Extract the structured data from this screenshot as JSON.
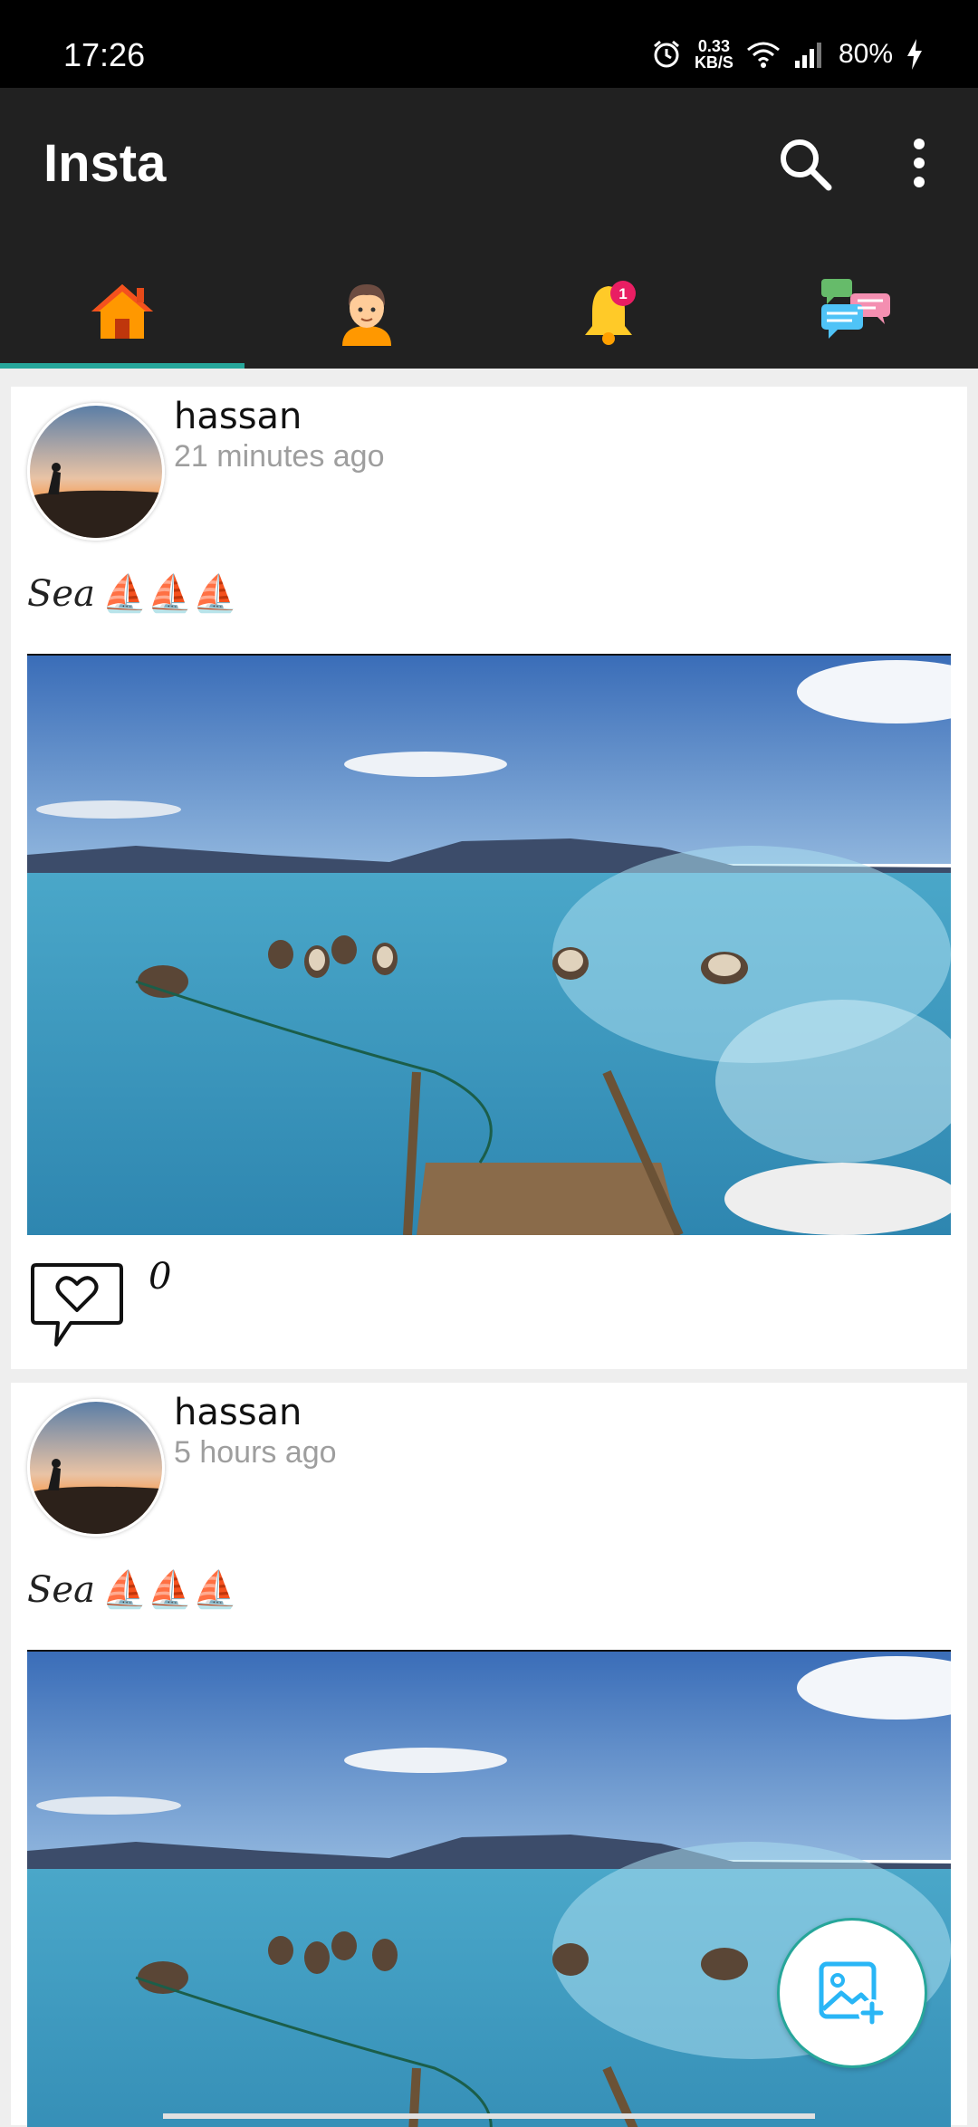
{
  "status_bar": {
    "time": "17:26",
    "net_speed_value": "0.33",
    "net_speed_unit": "KB/S",
    "battery": "80%"
  },
  "app_bar": {
    "title": "Insta",
    "actions": [
      "search-icon",
      "more-vert-icon"
    ]
  },
  "tabs": [
    {
      "icon": "home-icon",
      "selected": true
    },
    {
      "icon": "profile-icon",
      "selected": false
    },
    {
      "icon": "bell-icon",
      "badge": "1",
      "selected": false
    },
    {
      "icon": "chat-bubbles-icon",
      "selected": false
    }
  ],
  "posts": [
    {
      "username": "hassan",
      "time": "21 minutes ago",
      "caption": "Sea",
      "caption_emoji": "⛵⛵⛵",
      "likes": "0"
    },
    {
      "username": "hassan",
      "time": "5 hours ago",
      "caption": "Sea",
      "caption_emoji": "⛵⛵⛵"
    }
  ],
  "fab": {
    "icon": "add-image-icon"
  },
  "colors": {
    "app_bar": "#212121",
    "accent": "#26a69a",
    "background": "#eeeeee"
  }
}
